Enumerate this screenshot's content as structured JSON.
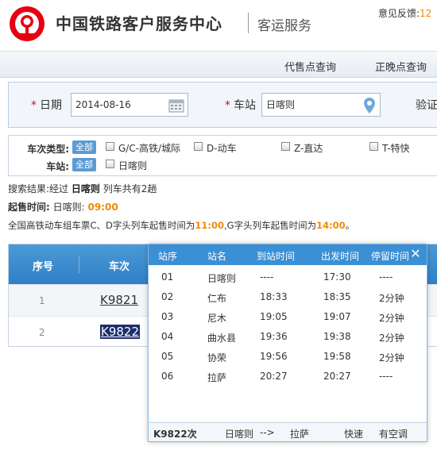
{
  "header": {
    "brand": "中国铁路客户服务中心",
    "subtitle": "客运服务",
    "feedback_label": "意见反馈:",
    "feedback_num": "12",
    "logo_color": "#e60012"
  },
  "nav": {
    "items": [
      {
        "label": "代售点查询"
      },
      {
        "label": "正晚点查询"
      }
    ]
  },
  "search": {
    "date_label": "日期",
    "date_value": "2014-08-16",
    "station_label": "车站",
    "station_value": "日喀则",
    "verify_label": "验证"
  },
  "filters": {
    "type_label": "车次类型:",
    "type_all": "全部",
    "type_options": [
      "G/C-高铁/城际",
      "D-动车",
      "Z-直达",
      "T-特快"
    ],
    "station_label": "车站:",
    "station_all": "全部",
    "station_options": [
      "日喀则"
    ]
  },
  "result": {
    "prefix": "搜索结果:经过 ",
    "station": "日喀则",
    "suffix": " 列车共有2趟"
  },
  "sale": {
    "label": "起售时间:",
    "station": "日喀则:",
    "time": "09:00"
  },
  "notice": {
    "part1": "全国高铁动车组车票C、D字头列车起售时间为",
    "time1": "11:00",
    "part2": ",G字头列车起售时间为",
    "time2": "14:00",
    "part3": "。"
  },
  "table": {
    "columns": [
      "序号",
      "车次"
    ],
    "rows": [
      {
        "idx": "1",
        "train": "K9821"
      },
      {
        "idx": "2",
        "train": "K9822"
      }
    ]
  },
  "popup": {
    "columns": [
      "站序",
      "站名",
      "到站时间",
      "出发时间",
      "停留时间"
    ],
    "rows": [
      {
        "seq": "01",
        "name": "日喀则",
        "arrive": "----",
        "depart": "17:30",
        "stay": "----"
      },
      {
        "seq": "02",
        "name": "仁布",
        "arrive": "18:33",
        "depart": "18:35",
        "stay": "2分钟"
      },
      {
        "seq": "03",
        "name": "尼木",
        "arrive": "19:05",
        "depart": "19:07",
        "stay": "2分钟"
      },
      {
        "seq": "04",
        "name": "曲水县",
        "arrive": "19:36",
        "depart": "19:38",
        "stay": "2分钟"
      },
      {
        "seq": "05",
        "name": "协荣",
        "arrive": "19:56",
        "depart": "19:58",
        "stay": "2分钟"
      },
      {
        "seq": "06",
        "name": "拉萨",
        "arrive": "20:27",
        "depart": "20:27",
        "stay": "----"
      }
    ],
    "footer": {
      "train": "K9822次",
      "from": "日喀则",
      "arrow": "-->",
      "to": "拉萨",
      "speed": "快速",
      "ac": "有空调"
    }
  }
}
